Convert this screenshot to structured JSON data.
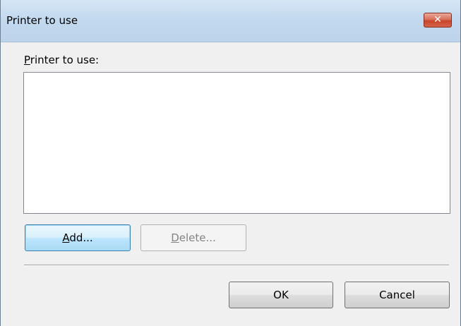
{
  "window": {
    "title": "Printer to use",
    "close_glyph": "✕"
  },
  "list": {
    "label_mnemonic": "P",
    "label_rest": "rinter to use:",
    "items": []
  },
  "buttons": {
    "add_mnemonic": "A",
    "add_rest": "dd...",
    "delete_mnemonic": "D",
    "delete_rest": "elete...",
    "ok": "OK",
    "cancel": "Cancel"
  },
  "icons": {
    "close": "close-icon"
  },
  "colors": {
    "titlebar": "#c3d9ef",
    "close_button": "#c8452c",
    "default_button_accent": "#3c7fb1"
  }
}
